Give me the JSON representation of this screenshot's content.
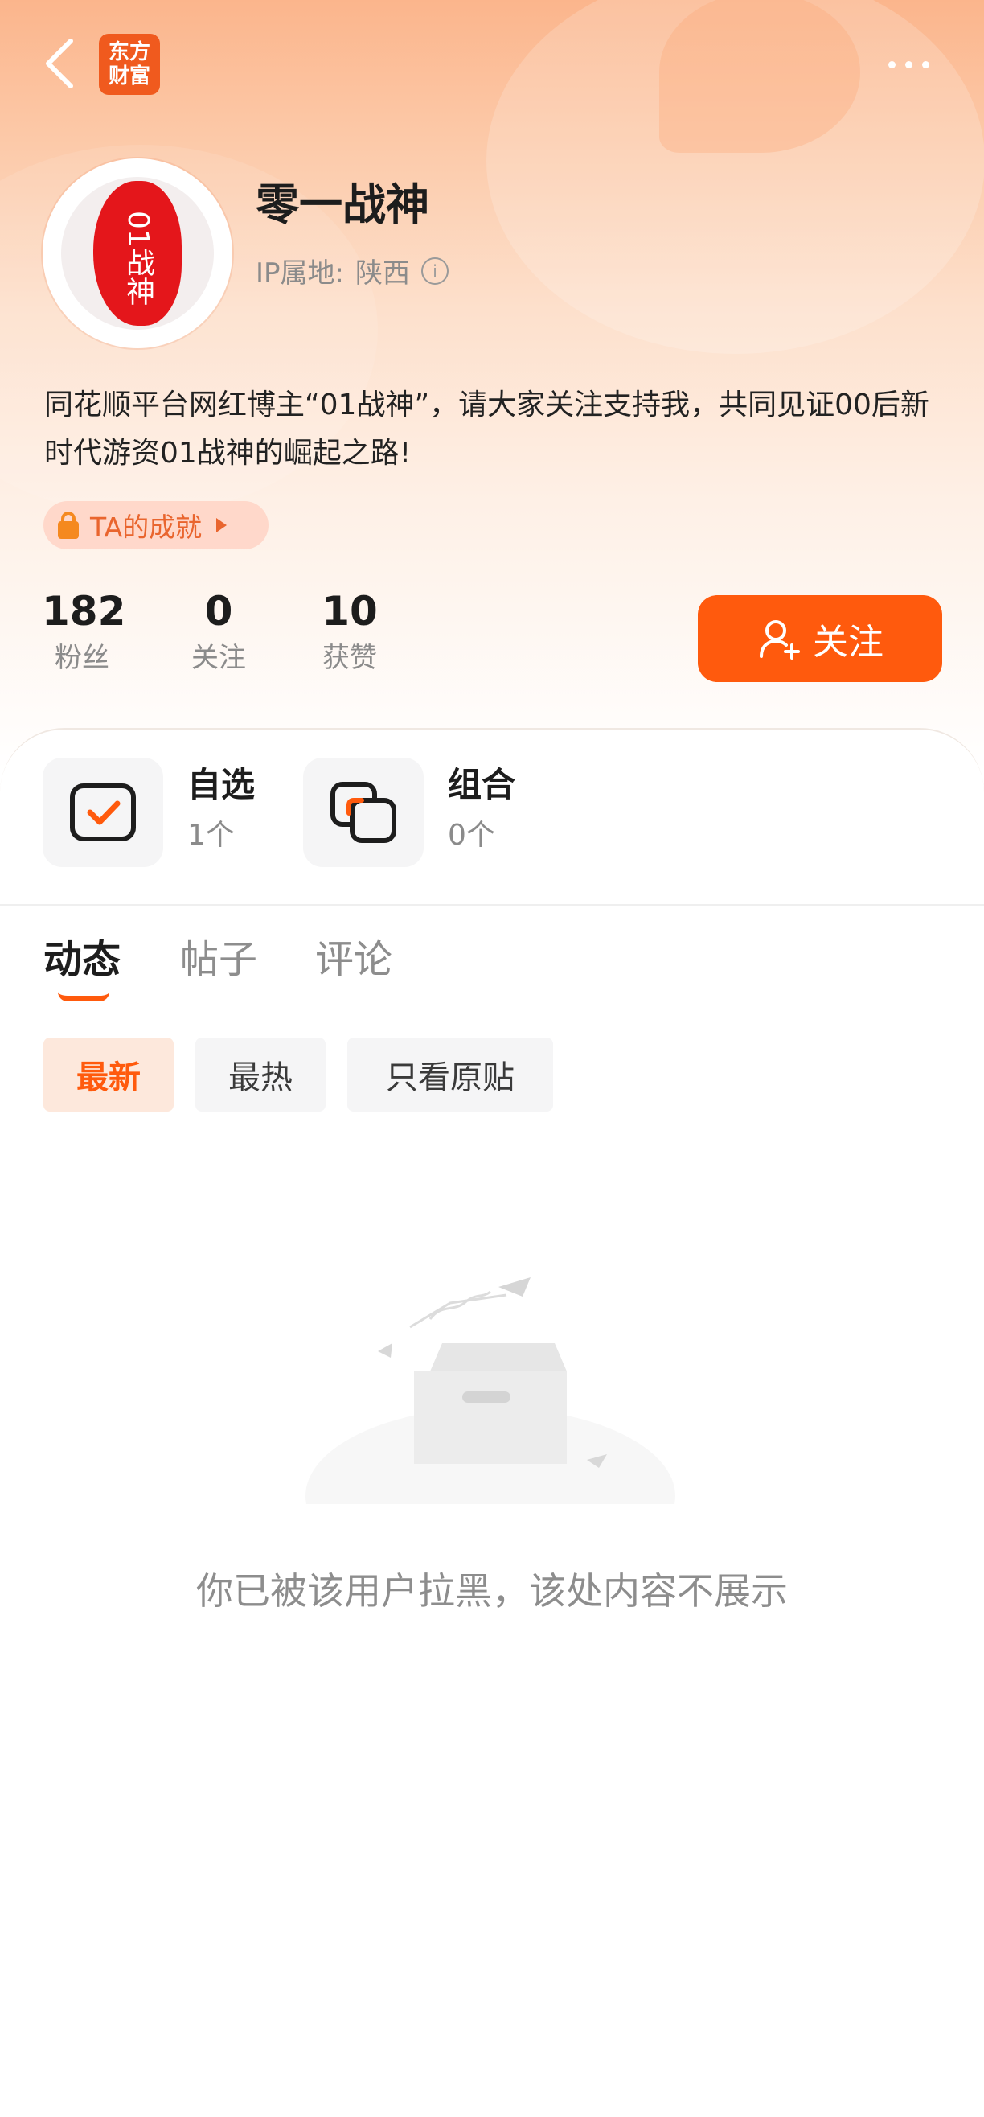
{
  "header": {
    "logo_line1": "东方",
    "logo_line2": "财富"
  },
  "profile": {
    "username": "零一战神",
    "ip_label": "IP属地:",
    "ip_location": "陕西",
    "avatar_text": "01战神",
    "bio": "同花顺平台网红博主“01战神”，请大家关注支持我，共同见证00后新时代游资01战神的崛起之路!",
    "achievement_label": "TA的成就"
  },
  "stats": [
    {
      "value": "182",
      "label": "粉丝"
    },
    {
      "value": "0",
      "label": "关注"
    },
    {
      "value": "10",
      "label": "获赞"
    }
  ],
  "follow_button": "关注",
  "watchlists": [
    {
      "title": "自选",
      "count": "1个"
    },
    {
      "title": "组合",
      "count": "0个"
    }
  ],
  "tabs": [
    {
      "label": "动态",
      "active": true
    },
    {
      "label": "帖子",
      "active": false
    },
    {
      "label": "评论",
      "active": false
    }
  ],
  "filters": [
    {
      "label": "最新",
      "active": true
    },
    {
      "label": "最热",
      "active": false
    },
    {
      "label": "只看原贴",
      "active": false
    }
  ],
  "empty_message": "你已被该用户拉黑，该处内容不展示",
  "colors": {
    "accent": "#ff5a0d",
    "logo": "#f05a1e",
    "avatar_seal": "#e4161b"
  }
}
